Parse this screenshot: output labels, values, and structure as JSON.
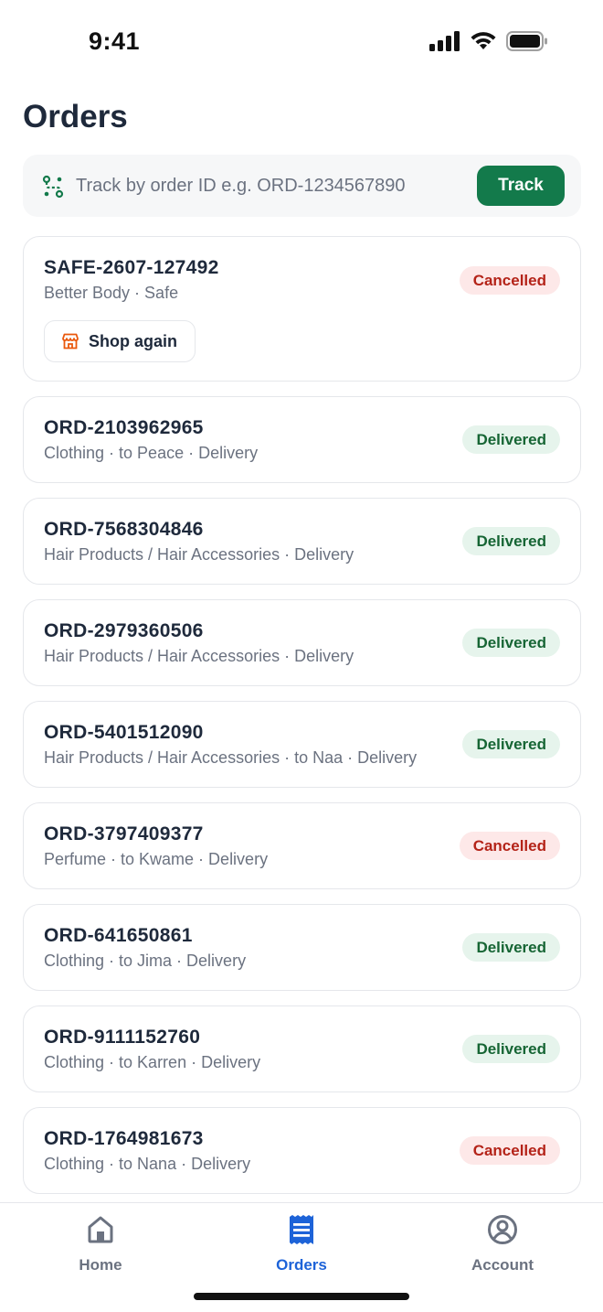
{
  "status_bar": {
    "time": "9:41"
  },
  "page": {
    "title": "Orders"
  },
  "track": {
    "placeholder": "Track by order ID e.g. ORD-1234567890",
    "button_label": "Track"
  },
  "orders": [
    {
      "id": "SAFE-2607-127492",
      "subtitle": "Better Body · Safe",
      "status": "Cancelled",
      "action_label": "Shop again"
    },
    {
      "id": "ORD-2103962965",
      "subtitle": "Clothing · to Peace · Delivery",
      "status": "Delivered"
    },
    {
      "id": "ORD-7568304846",
      "subtitle": "Hair Products / Hair Accessories · Delivery",
      "status": "Delivered"
    },
    {
      "id": "ORD-2979360506",
      "subtitle": "Hair Products / Hair Accessories · Delivery",
      "status": "Delivered"
    },
    {
      "id": "ORD-5401512090",
      "subtitle": "Hair Products / Hair Accessories · to Naa · Delivery",
      "status": "Delivered"
    },
    {
      "id": "ORD-3797409377",
      "subtitle": "Perfume · to Kwame · Delivery",
      "status": "Cancelled"
    },
    {
      "id": "ORD-641650861",
      "subtitle": "Clothing · to Jima · Delivery",
      "status": "Delivered"
    },
    {
      "id": "ORD-9111152760",
      "subtitle": "Clothing · to Karren · Delivery",
      "status": "Delivered"
    },
    {
      "id": "ORD-1764981673",
      "subtitle": "Clothing · to Nana · Delivery",
      "status": "Cancelled"
    }
  ],
  "nav": {
    "home_label": "Home",
    "orders_label": "Orders",
    "account_label": "Account"
  },
  "colors": {
    "accent_green": "#137a4b",
    "active_blue": "#1d63d8",
    "delivered_text": "#166534",
    "cancelled_text": "#b42318"
  },
  "icons": {
    "track": "route-icon",
    "shop_again": "storefront-icon",
    "home": "home-icon",
    "orders": "receipt-icon",
    "account": "user-circle-icon"
  }
}
